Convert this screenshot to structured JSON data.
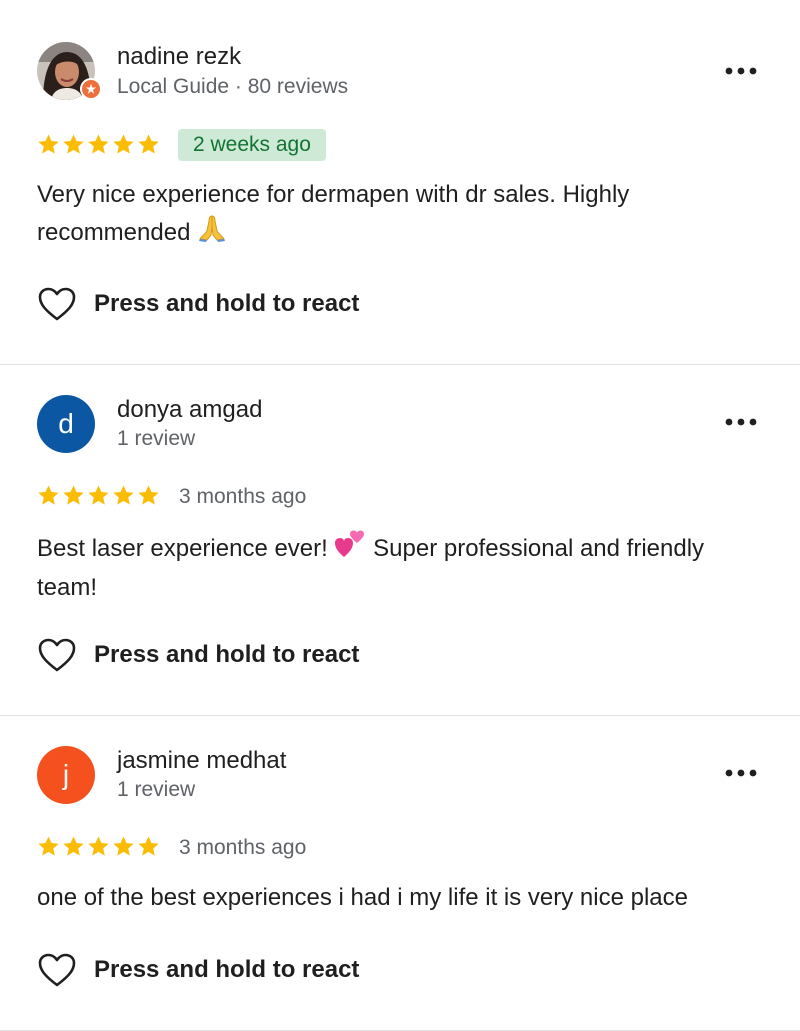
{
  "reviews": [
    {
      "name": "nadine rezk",
      "meta": "Local Guide · 80 reviews",
      "avatar": {
        "type": "photo",
        "badge": "local-guide-badge",
        "badge_color": "#ee6f3b"
      },
      "rating": 5,
      "time": "2 weeks ago",
      "time_highlight": true,
      "text_before": "Very nice experience for dermapen with dr sales. Highly recommended ",
      "emoji": "folded-hands",
      "text_after": "",
      "react_label": "Press and hold to react"
    },
    {
      "name": "donya amgad",
      "meta": "1 review",
      "avatar": {
        "type": "letter",
        "letter": "d",
        "color": "#0b57a3"
      },
      "rating": 5,
      "time": "3 months ago",
      "time_highlight": false,
      "text_before": "Best laser experience ever! ",
      "emoji": "two-hearts",
      "text_after": " Super professional and friendly team!",
      "react_label": "Press and hold to react"
    },
    {
      "name": "jasmine medhat",
      "meta": "1 review",
      "avatar": {
        "type": "letter",
        "letter": "j",
        "color": "#f4511e"
      },
      "rating": 5,
      "time": "3 months ago",
      "time_highlight": false,
      "text_before": "one of the best experiences i had i my life it is very nice place",
      "emoji": "",
      "text_after": "",
      "react_label": "Press and hold to react"
    }
  ],
  "colors": {
    "star": "#fbbc04",
    "divider": "#e3e3e3",
    "meta_text": "#5f6368",
    "highlight_bg": "#ceead6",
    "highlight_text": "#137333"
  }
}
